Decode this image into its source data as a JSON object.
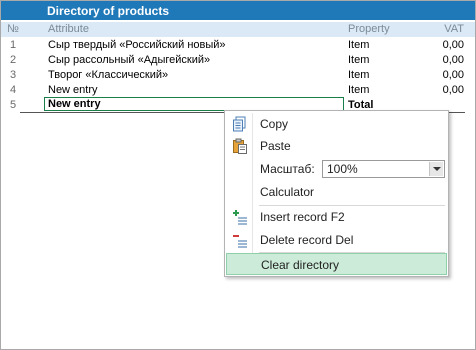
{
  "title": "Directory of products",
  "columns": {
    "num": "№",
    "attribute": "Attribute",
    "property": "Property",
    "vat": "VAT"
  },
  "rows": [
    {
      "num": "1",
      "attribute": "Сыр твердый «Российский новый»",
      "property": "Item",
      "vat": "0,00"
    },
    {
      "num": "2",
      "attribute": "Сыр рассольный «Адыгейский»",
      "property": "Item",
      "vat": "0,00"
    },
    {
      "num": "3",
      "attribute": "Творог «Классический»",
      "property": "Item",
      "vat": "0,00"
    },
    {
      "num": "4",
      "attribute": "New entry",
      "property": "Item",
      "vat": "0,00"
    }
  ],
  "new_row": {
    "num": "5",
    "attribute": "New entry",
    "property": "Total"
  },
  "context_menu": {
    "copy": "Copy",
    "paste": "Paste",
    "zoom_label": "Масштаб:",
    "zoom_value": "100%",
    "calculator": "Calculator",
    "insert": "Insert record  F2",
    "delete": "Delete record Del",
    "clear": "Clear directory"
  },
  "colors": {
    "title_bg": "#1f79b9",
    "header_bg": "#dbe9f6",
    "selection_bg": "#ccecd9",
    "cell_border": "#1a7e4a"
  }
}
